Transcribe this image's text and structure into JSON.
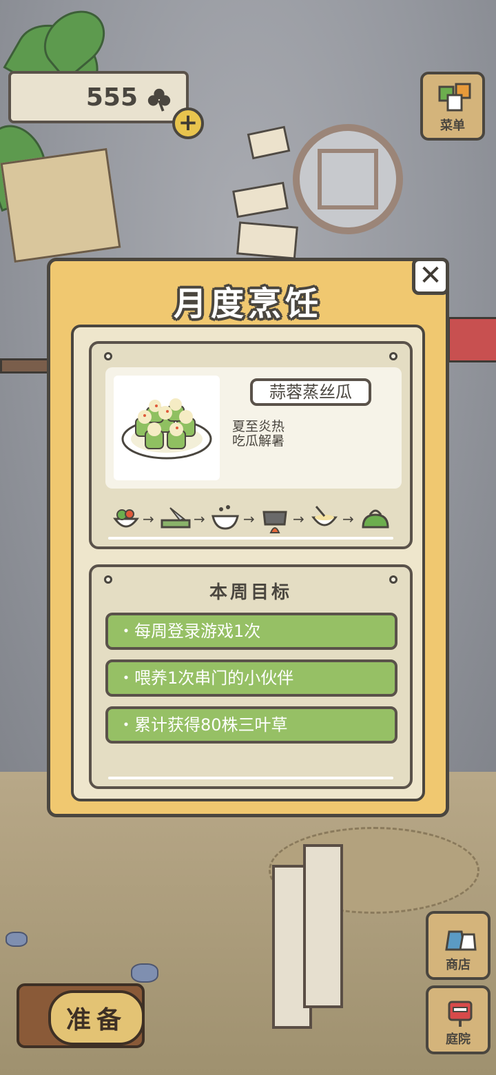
{
  "currency": {
    "value": "555",
    "icon": "clover-icon"
  },
  "menu_button": {
    "label": "菜单"
  },
  "shop_button": {
    "label": "商店"
  },
  "garden_button": {
    "label": "庭院"
  },
  "prepare_button": {
    "label": "准备"
  },
  "modal": {
    "title": "月度烹饪",
    "close_icon": "close-icon",
    "recipe": {
      "name": "蒜蓉蒸丝瓜",
      "description_line1": "夏至炎热",
      "description_line2": "吃瓜解暑",
      "steps": [
        "vegetables-icon",
        "cutting-icon",
        "pot-icon",
        "cooking-pot-fire-icon",
        "bowl-spoon-icon",
        "bag-icon"
      ]
    },
    "weekly_goals": {
      "title": "本周目标",
      "items": [
        "・每周登录游戏1次",
        "・喂养1次串门的小伙伴",
        "・累计获得80株三叶草"
      ]
    }
  },
  "colors": {
    "modal_bg": "#f0c870",
    "goal_green": "#96c065",
    "outline": "#4a463f"
  }
}
